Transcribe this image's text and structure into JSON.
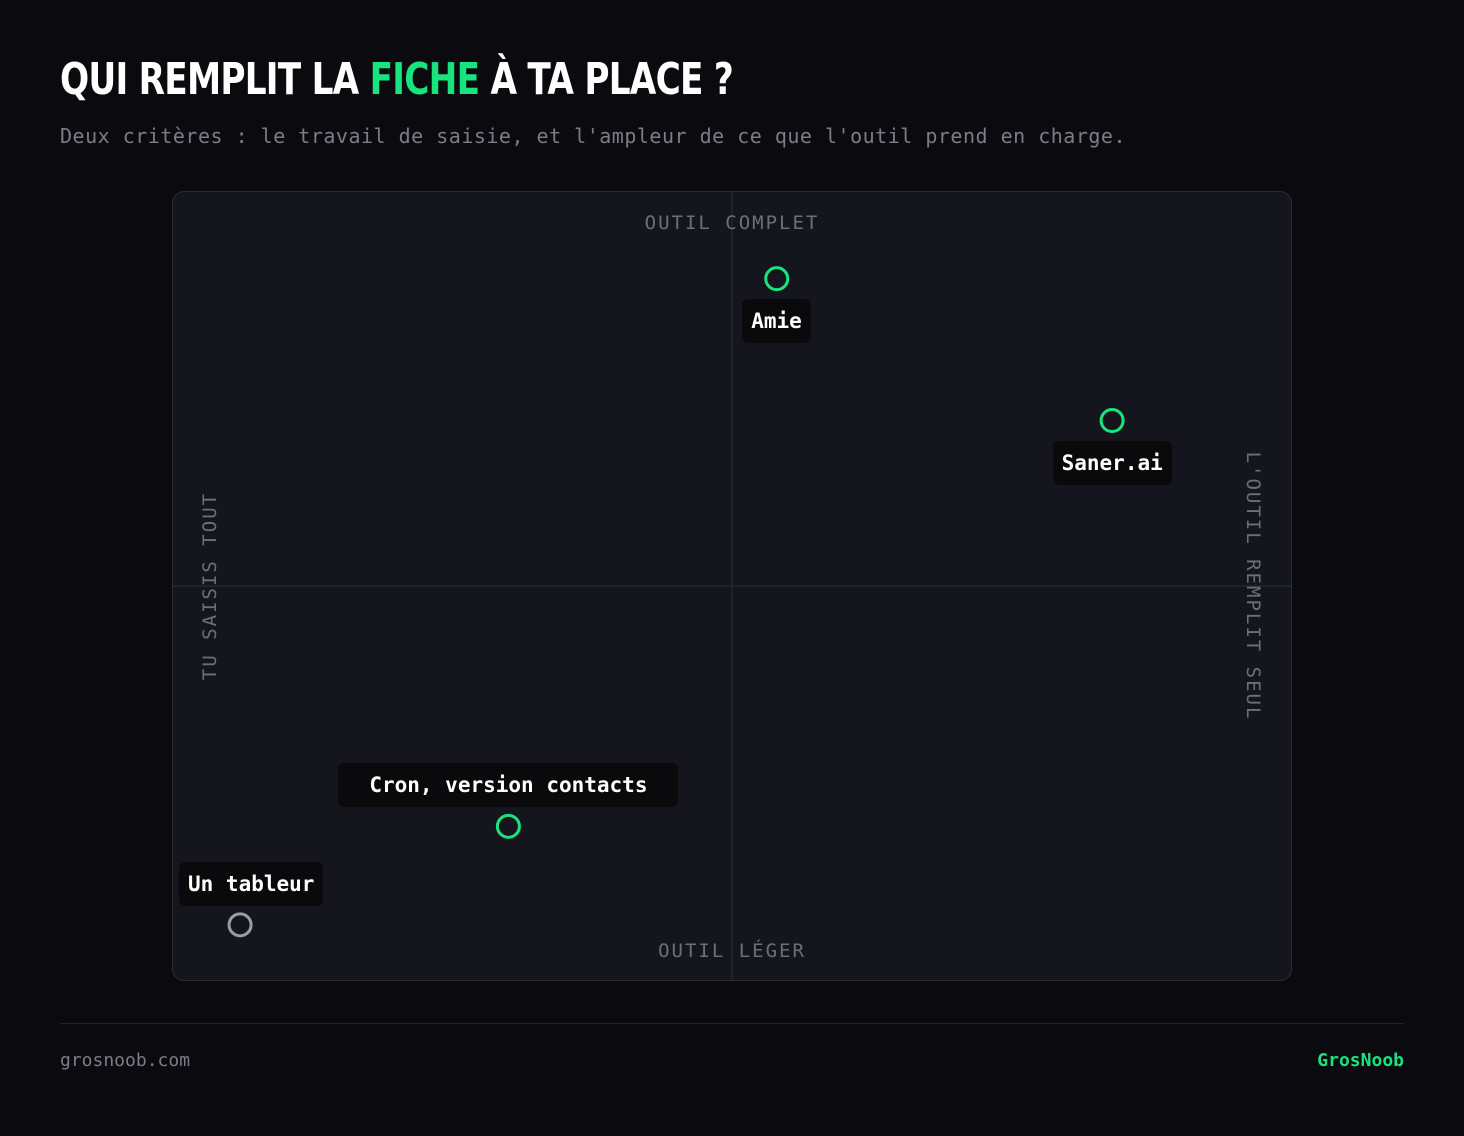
{
  "header": {
    "title_before": "Qui remplit la ",
    "title_accent": "fiche",
    "title_after": " à ta place ?",
    "subtitle": "Deux critères : le travail de saisie, et l'ampleur de ce que l'outil prend en charge."
  },
  "colors": {
    "accent": "#19e37e",
    "muted_marker": "#9a9ca6",
    "background": "#0b0b0f",
    "panel": "#15161d"
  },
  "chart_data": {
    "type": "scatter",
    "axes": {
      "top": "Outil complet",
      "bottom": "Outil léger",
      "left": "Tu saisis tout",
      "right": "L'outil remplit seul"
    },
    "xlim": [
      -1,
      1
    ],
    "ylim": [
      -1,
      1
    ],
    "grid": false,
    "points": [
      {
        "label": "Amie",
        "x": 0.08,
        "y": 0.78,
        "color": "#19e37e",
        "label_side": "below"
      },
      {
        "label": "Saner.ai",
        "x": 0.68,
        "y": 0.42,
        "color": "#19e37e",
        "label_side": "below"
      },
      {
        "label": "Cron, version contacts",
        "x": -0.4,
        "y": -0.61,
        "color": "#19e37e",
        "label_side": "above"
      },
      {
        "label": "Un tableur",
        "x": -0.88,
        "y": -0.86,
        "color": "#9a9ca6",
        "label_side": "above"
      }
    ]
  },
  "footer": {
    "site": "grosnoob.com",
    "brand": "GrosNoob"
  }
}
